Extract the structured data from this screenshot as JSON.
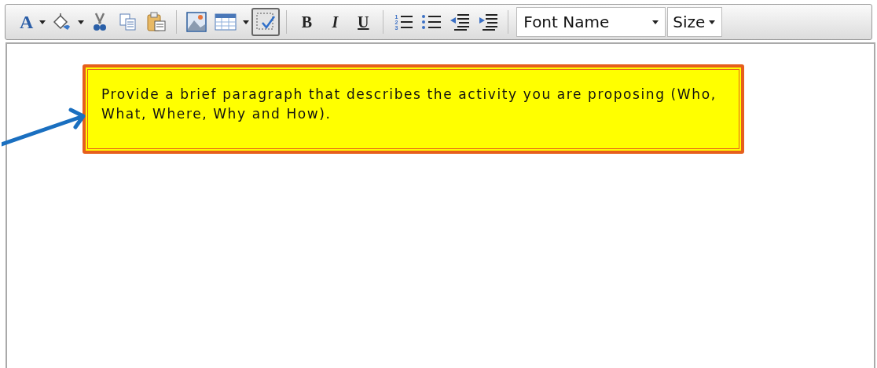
{
  "toolbar": {
    "items": [
      {
        "kind": "text-color",
        "label": "A",
        "dropdown": true,
        "selected": false
      },
      {
        "kind": "fill-color",
        "dropdown": true,
        "selected": false
      },
      {
        "kind": "cut",
        "dropdown": false,
        "selected": false
      },
      {
        "kind": "copy",
        "dropdown": false,
        "selected": false
      },
      {
        "kind": "paste",
        "dropdown": false,
        "selected": false
      },
      {
        "kind": "separator"
      },
      {
        "kind": "image",
        "dropdown": false,
        "selected": false
      },
      {
        "kind": "table",
        "dropdown": true,
        "selected": false
      },
      {
        "kind": "select-all",
        "dropdown": false,
        "selected": true
      },
      {
        "kind": "separator"
      },
      {
        "kind": "bold",
        "label": "B",
        "dropdown": false,
        "selected": false
      },
      {
        "kind": "italic",
        "label": "I",
        "dropdown": false,
        "selected": false
      },
      {
        "kind": "underline",
        "label": "U",
        "dropdown": false,
        "selected": false
      },
      {
        "kind": "separator"
      },
      {
        "kind": "ordered-list",
        "label": "123",
        "dropdown": false,
        "selected": false
      },
      {
        "kind": "bullet-list",
        "dropdown": false,
        "selected": false
      },
      {
        "kind": "outdent",
        "dropdown": false,
        "selected": false
      },
      {
        "kind": "indent",
        "dropdown": false,
        "selected": false
      },
      {
        "kind": "separator"
      }
    ],
    "font_name": {
      "value": "Font Name"
    },
    "size": {
      "value": "Size"
    }
  },
  "callout": {
    "text": "Provide a brief paragraph that describes the activity you are proposing (Who, What, Where, Why and How)."
  }
}
